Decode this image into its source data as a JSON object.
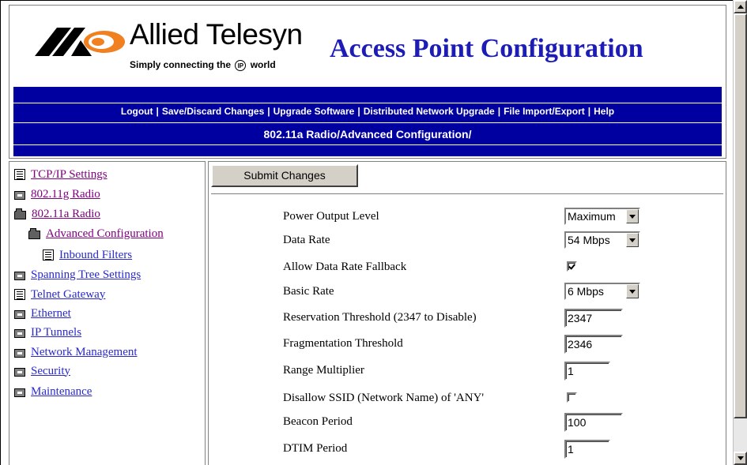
{
  "brand": {
    "name": "Allied Telesyn",
    "tagline_pre": "Simply connecting the",
    "tagline_ip": "IP",
    "tagline_post": "world",
    "logo_icon": "allied-telesyn-logo",
    "logo_colors": {
      "black": "#000000",
      "orange": "#f08020"
    }
  },
  "app": {
    "title": "Access Point Configuration",
    "title_color": "#1d1db5"
  },
  "nav": {
    "bar_color": "#0000a0",
    "links": [
      "Logout",
      "Save/Discard Changes",
      "Upgrade Software",
      "Distributed Network Upgrade",
      "File Import/Export",
      "Help"
    ],
    "separator": "|"
  },
  "breadcrumb": "802.11a Radio/Advanced Configuration/",
  "tree": {
    "items": [
      {
        "label": "TCP/IP Settings",
        "icon": "document-icon",
        "visited": true
      },
      {
        "label": "802.11g Radio",
        "icon": "folder-icon",
        "visited": true
      },
      {
        "label": "802.11a Radio",
        "icon": "folder-open-icon",
        "visited": true
      },
      {
        "label": "Advanced Configuration",
        "icon": "folder-open-icon",
        "visited": true
      },
      {
        "label": "Inbound Filters",
        "icon": "document-icon",
        "visited": false
      },
      {
        "label": "Spanning Tree Settings",
        "icon": "folder-icon",
        "visited": false
      },
      {
        "label": "Telnet Gateway",
        "icon": "document-icon",
        "visited": false
      },
      {
        "label": "Ethernet",
        "icon": "folder-icon",
        "visited": false
      },
      {
        "label": "IP Tunnels",
        "icon": "folder-icon",
        "visited": false
      },
      {
        "label": "Network Management",
        "icon": "folder-icon",
        "visited": false
      },
      {
        "label": "Security",
        "icon": "folder-icon",
        "visited": false
      },
      {
        "label": "Maintenance",
        "icon": "folder-icon",
        "visited": false
      }
    ]
  },
  "form": {
    "submit_label": "Submit Changes",
    "fields": [
      {
        "label": "Power Output Level",
        "type": "select",
        "value": "Maximum"
      },
      {
        "label": "Data Rate",
        "type": "select",
        "value": "54 Mbps"
      },
      {
        "label": "Allow Data Rate Fallback",
        "type": "checkbox",
        "checked": true
      },
      {
        "label": "Basic Rate",
        "type": "select",
        "value": "6 Mbps"
      },
      {
        "label": "Reservation Threshold (2347 to Disable)",
        "type": "text",
        "value": "2347"
      },
      {
        "label": "Fragmentation Threshold",
        "type": "text",
        "value": "2346"
      },
      {
        "label": "Range Multiplier",
        "type": "text",
        "value": "1"
      },
      {
        "label": "Disallow SSID (Network Name) of 'ANY'",
        "type": "checkbox",
        "checked": false
      },
      {
        "label": "Beacon Period",
        "type": "text",
        "value": "100"
      },
      {
        "label": "DTIM Period",
        "type": "text",
        "value": "1"
      }
    ]
  }
}
